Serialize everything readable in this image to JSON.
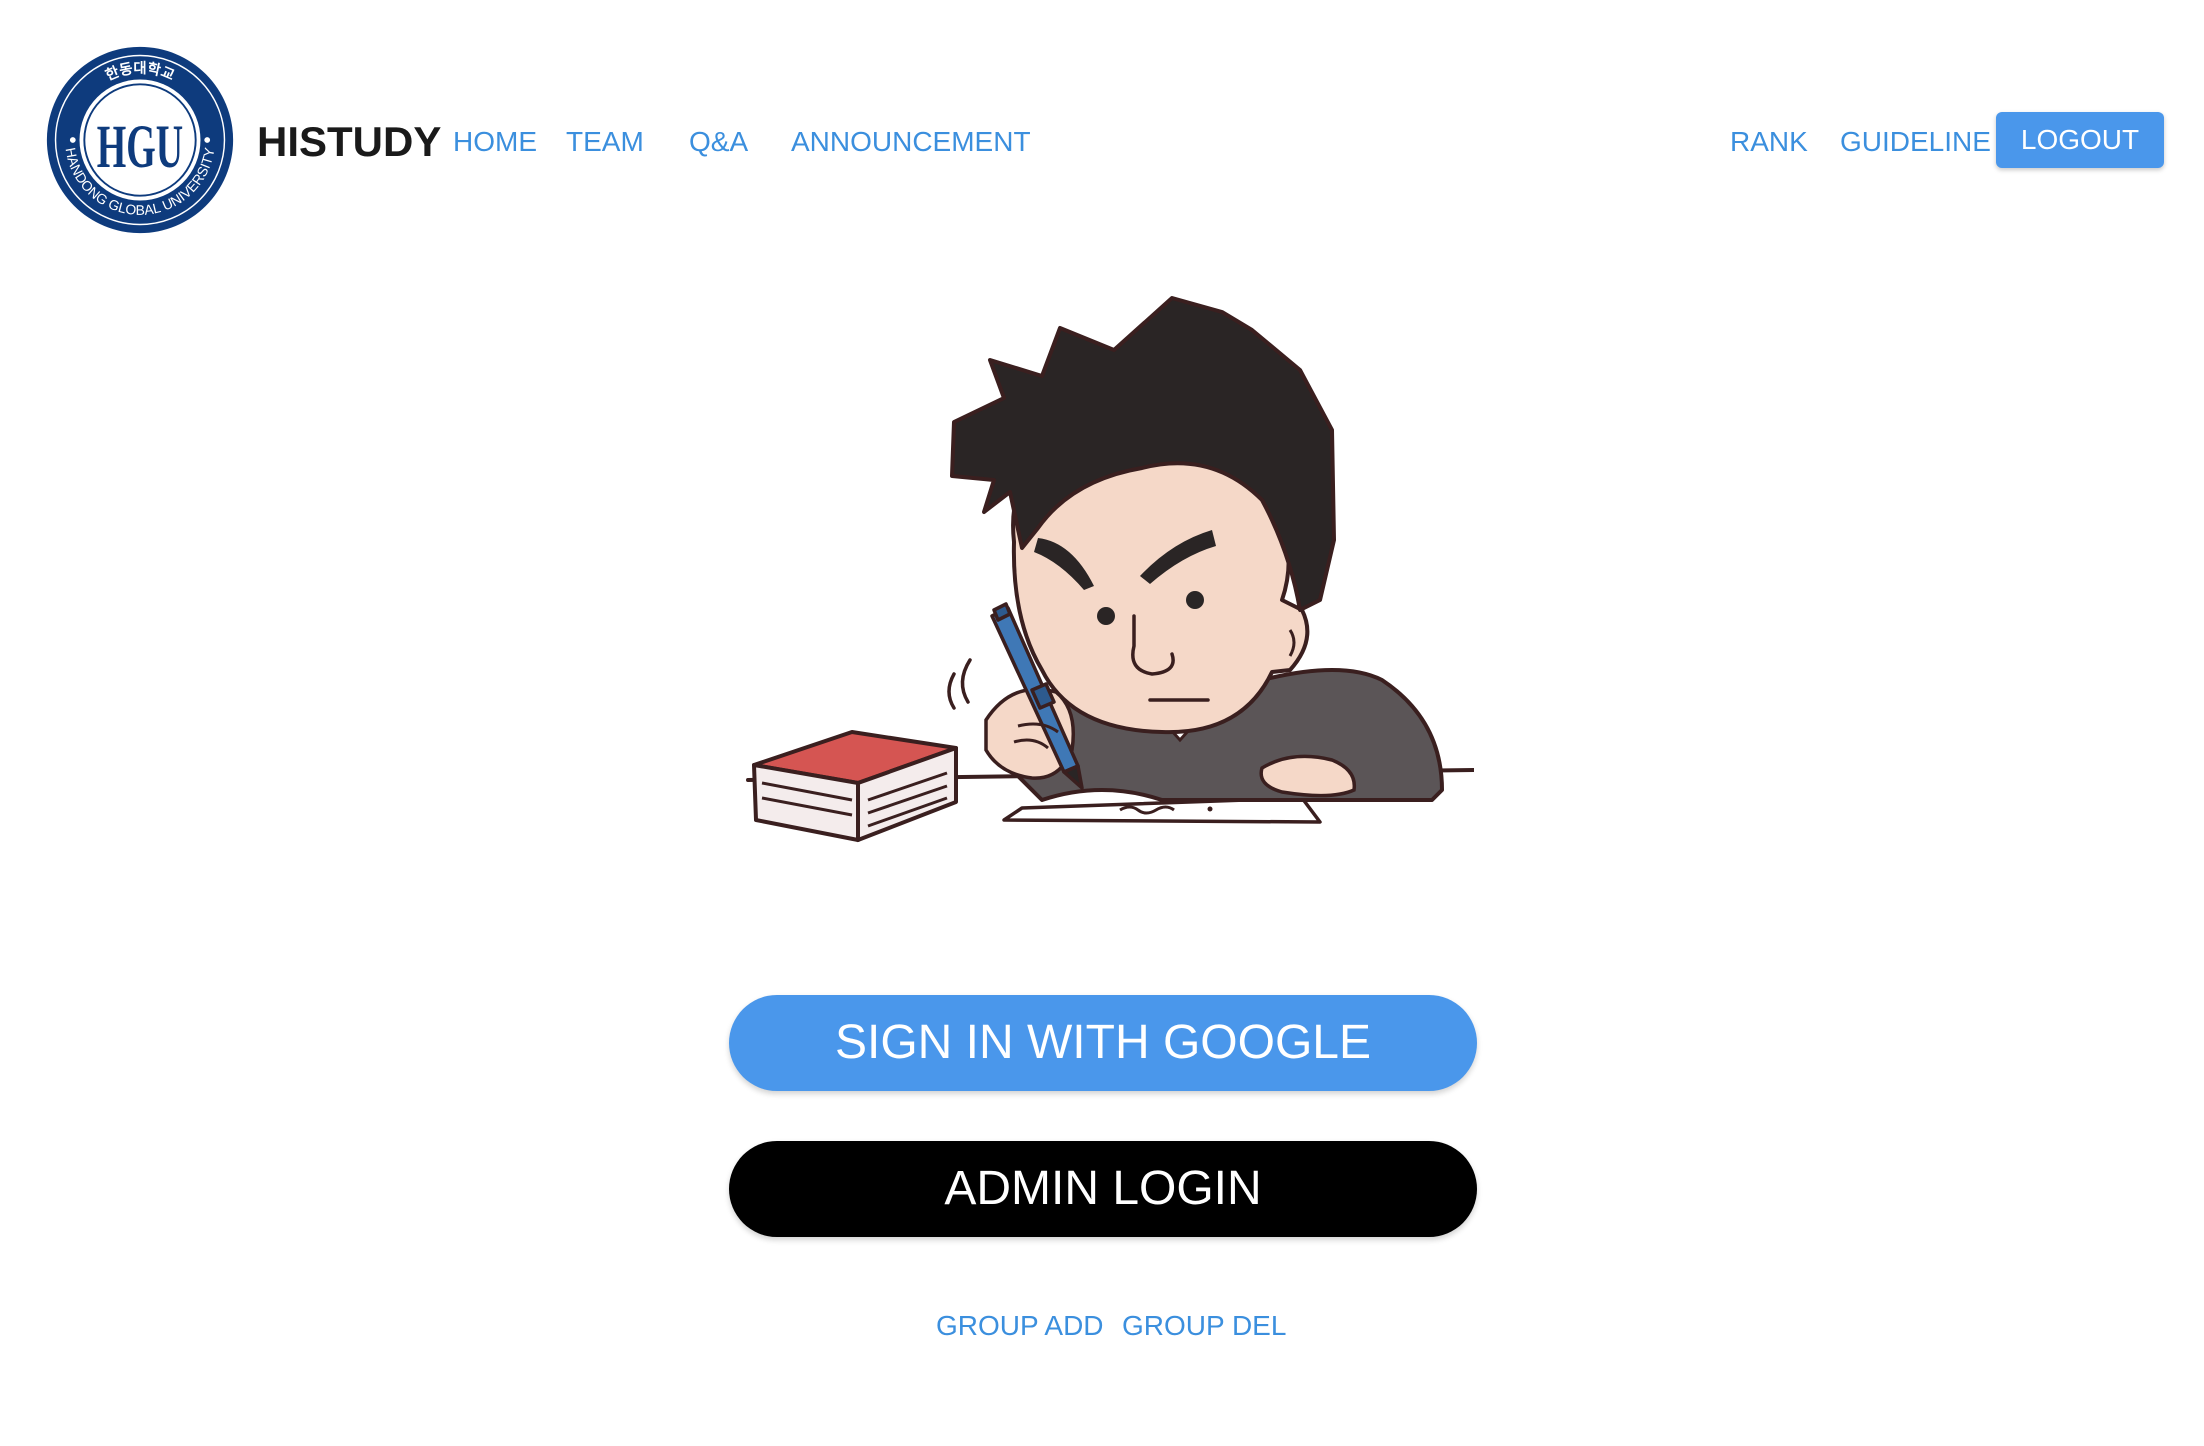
{
  "header": {
    "logo": {
      "icon": "hgu-seal-icon",
      "seal_text_outer": "HANDONG GLOBAL UNIVERSITY",
      "seal_text_korean": "한동대학교",
      "monogram": "HGU",
      "color": "#0e3b7d"
    },
    "brand": "HISTUDY",
    "nav_left": [
      "HOME",
      "TEAM",
      "Q&A",
      "ANNOUNCEMENT"
    ],
    "nav_right": [
      "RANK",
      "GUIDELINE"
    ],
    "logout_label": "LOGOUT",
    "accent_color": "#4a97eb",
    "link_color": "#3b8fde"
  },
  "main": {
    "illustration_icon": "student-studying-illustration",
    "google_button_label": "SIGN IN WITH GOOGLE",
    "admin_button_label": "ADMIN LOGIN",
    "group_links": [
      "GROUP ADD",
      "GROUP DEL"
    ]
  }
}
